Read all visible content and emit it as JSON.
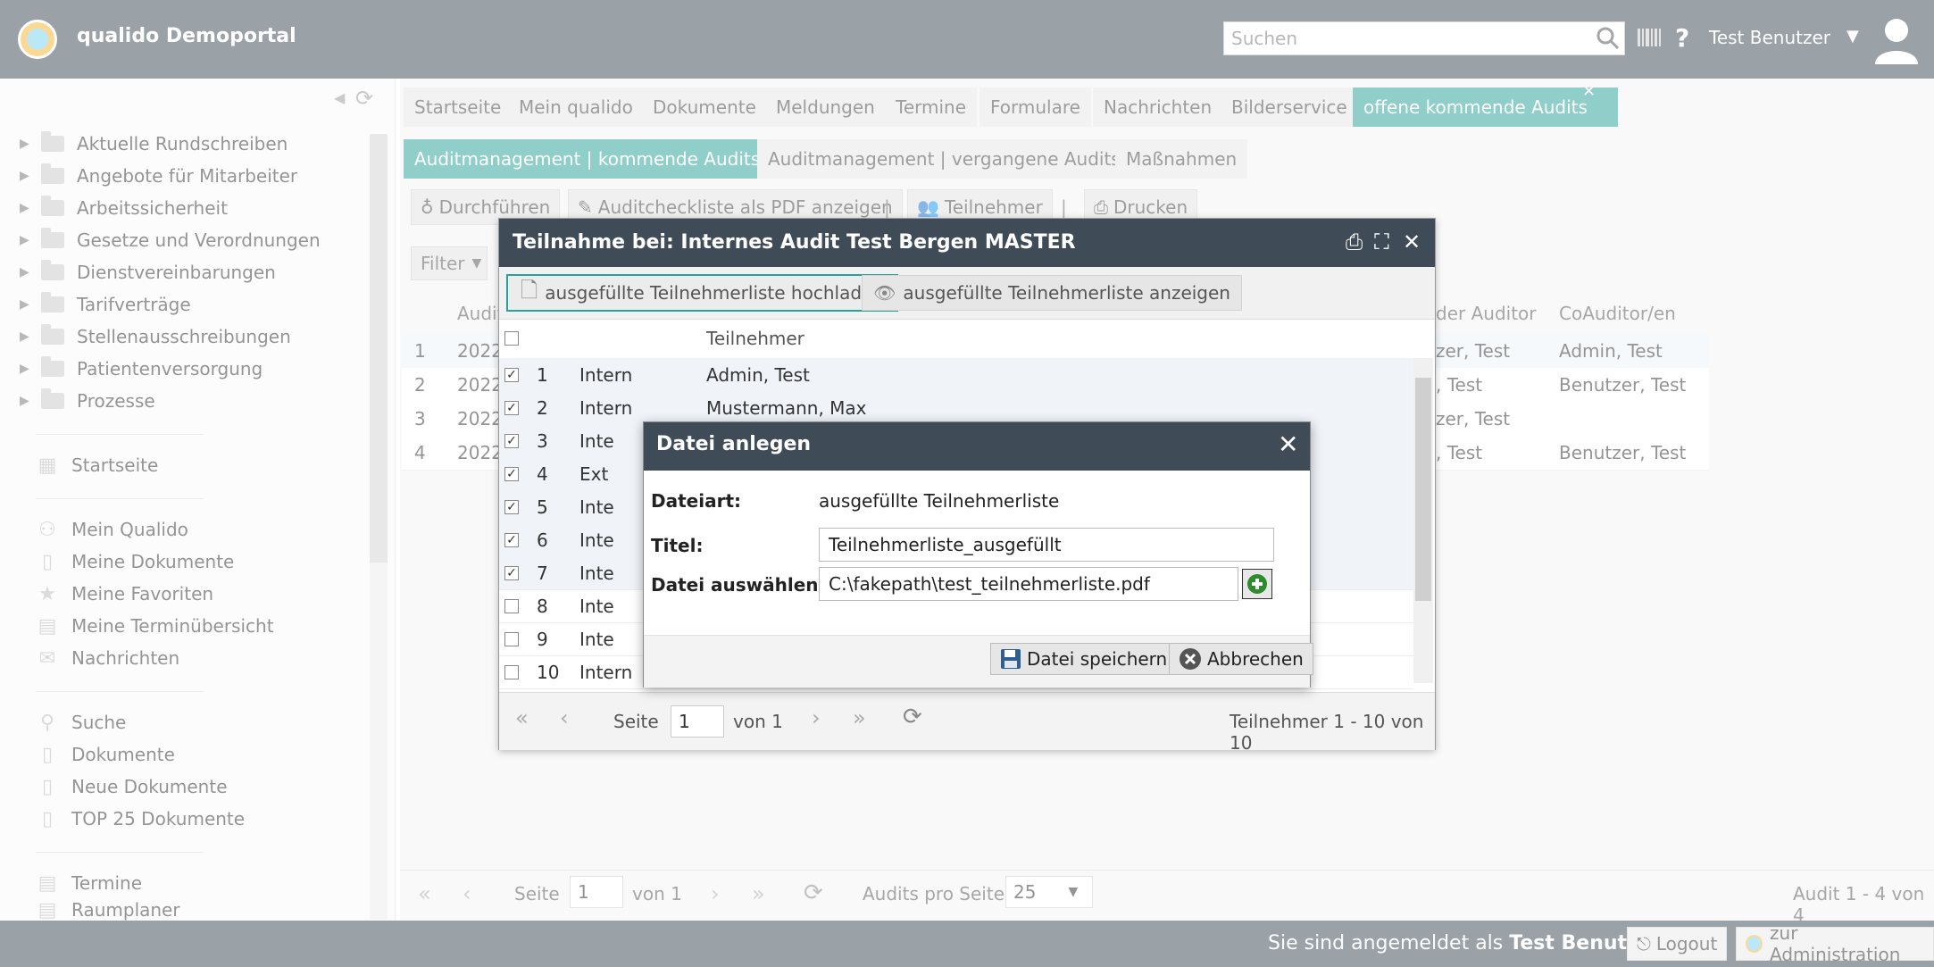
{
  "header": {
    "app_title": "qualido Demoportal",
    "search_placeholder": "Suchen",
    "user_name": "Test Benutzer"
  },
  "sidebar": {
    "tree": [
      "Aktuelle Rundschreiben",
      "Angebote für Mitarbeiter",
      "Arbeitssicherheit",
      "Gesetze und Verordnungen",
      "Dienstvereinbarungen",
      "Tarifverträge",
      "Stellenausschreibungen",
      "Patientenversorgung",
      "Prozesse"
    ],
    "group1": [
      "Startseite"
    ],
    "group2": [
      "Mein Qualido",
      "Meine Dokumente",
      "Meine Favoriten",
      "Meine Terminübersicht",
      "Nachrichten"
    ],
    "group3": [
      "Suche",
      "Dokumente",
      "Neue Dokumente",
      "TOP 25 Dokumente"
    ],
    "group4": [
      "Termine",
      "Raumplaner"
    ]
  },
  "tabs": [
    "Startseite",
    "Mein qualido",
    "Dokumente",
    "Meldungen",
    "Termine",
    "Formulare",
    "Nachrichten",
    "Bilderservice",
    "offene kommende Audits"
  ],
  "subtabs": [
    "Auditmanagement | kommende Audits",
    "Auditmanagement | vergangene Audits",
    "Maßnahmen"
  ],
  "toolbar": {
    "execute": "Durchführen",
    "pdf": "Auditcheckliste als PDF anzeigen",
    "participants": "Teilnehmer",
    "print": "Drucken",
    "filter": "Filter"
  },
  "audit_table": {
    "headers": [
      "Audit",
      "der Auditor",
      "CoAuditor/en"
    ],
    "rows": [
      {
        "n": "1",
        "audit": "2022",
        "auditor": "zer, Test",
        "co": "Admin, Test"
      },
      {
        "n": "2",
        "audit": "2022",
        "auditor": ", Test",
        "co": "Benutzer, Test"
      },
      {
        "n": "3",
        "audit": "2022",
        "auditor": "zer, Test",
        "co": ""
      },
      {
        "n": "4",
        "audit": "2022",
        "auditor": ", Test",
        "co": "Benutzer, Test"
      }
    ]
  },
  "bottom_pager": {
    "page_label": "Seite",
    "page": "1",
    "of": "von 1",
    "per_page_label": "Audits pro Seite:",
    "per_page": "25",
    "summary": "Audit 1 - 4 von 4"
  },
  "footer": {
    "logged_in_prefix": "Sie sind angemeldet als",
    "logged_in_user": "Test Benutzer",
    "logout": "Logout",
    "admin": "zur Administration"
  },
  "dialog_participants": {
    "title": "Teilnahme bei: Internes Audit Test Bergen MASTER",
    "upload": "ausgefüllte Teilnehmerliste hochladen",
    "show": "ausgefüllte Teilnehmerliste anzeigen",
    "col_participant": "Teilnehmer",
    "rows": [
      {
        "n": "1",
        "type": "Intern",
        "name": "Admin, Test",
        "checked": true
      },
      {
        "n": "2",
        "type": "Intern",
        "name": "Mustermann, Max",
        "checked": true
      },
      {
        "n": "3",
        "type": "Inte",
        "name": "",
        "checked": true
      },
      {
        "n": "4",
        "type": "Ext",
        "name": "",
        "checked": true
      },
      {
        "n": "5",
        "type": "Inte",
        "name": "",
        "checked": true
      },
      {
        "n": "6",
        "type": "Inte",
        "name": "",
        "checked": true
      },
      {
        "n": "7",
        "type": "Inte",
        "name": "",
        "checked": true
      },
      {
        "n": "8",
        "type": "Inte",
        "name": "",
        "checked": false
      },
      {
        "n": "9",
        "type": "Inte",
        "name": "",
        "checked": false
      },
      {
        "n": "10",
        "type": "Intern",
        "name": "",
        "checked": false
      }
    ],
    "pager": {
      "page_label": "Seite",
      "page": "1",
      "of": "von 1",
      "summary": "Teilnehmer 1 - 10 von 10"
    }
  },
  "dialog_file": {
    "title": "Datei anlegen",
    "type_label": "Dateiart:",
    "type_value": "ausgefüllte Teilnehmerliste",
    "title_label": "Titel:",
    "title_value": "Teilnehmerliste_ausgefüllt",
    "file_label": "Datei auswählen:",
    "file_value": "C:\\fakepath\\test_teilnehmerliste.pdf",
    "save": "Datei speichern",
    "cancel": "Abbrechen"
  }
}
